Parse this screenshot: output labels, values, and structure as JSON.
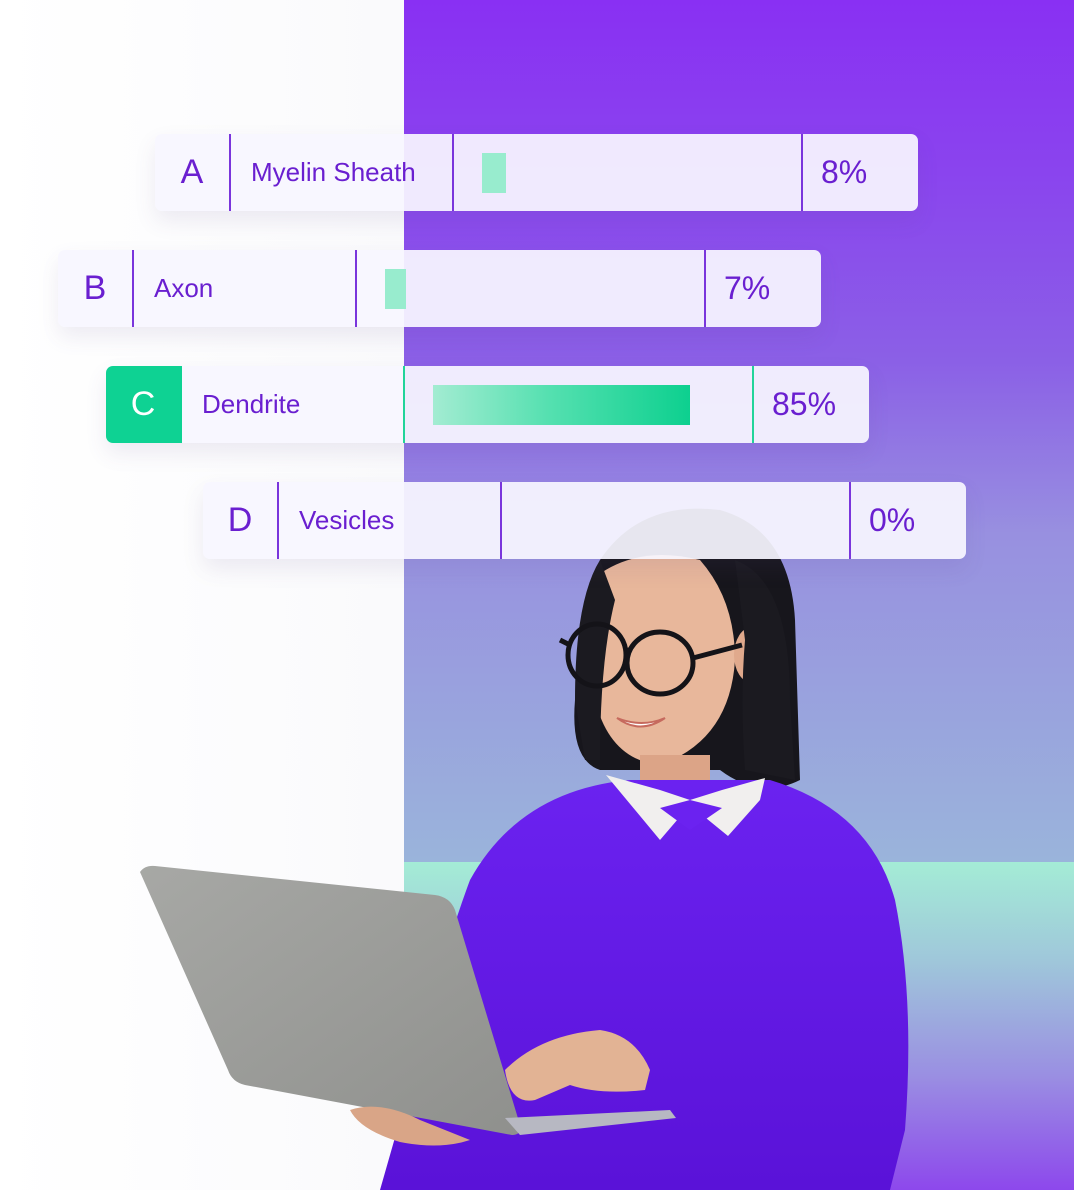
{
  "quiz": {
    "answers": [
      {
        "letter": "A",
        "label": "Myelin Sheath",
        "percent_label": "8%",
        "percent": 8,
        "correct": false
      },
      {
        "letter": "B",
        "label": "Axon",
        "percent_label": "7%",
        "percent": 7,
        "correct": false
      },
      {
        "letter": "C",
        "label": "Dendrite",
        "percent_label": "85%",
        "percent": 85,
        "correct": true
      },
      {
        "letter": "D",
        "label": "Vesicles",
        "percent_label": "0%",
        "percent": 0,
        "correct": false
      }
    ]
  },
  "colors": {
    "accent_purple": "#6a1fd0",
    "correct_green": "#0ed293",
    "bar_mint": "#98ecce",
    "bg_purple_top": "#8930f3",
    "bg_mint_band": "#a4ecd6"
  },
  "photo": {
    "subject": "smiling woman with glasses in purple sweater holding laptop"
  }
}
